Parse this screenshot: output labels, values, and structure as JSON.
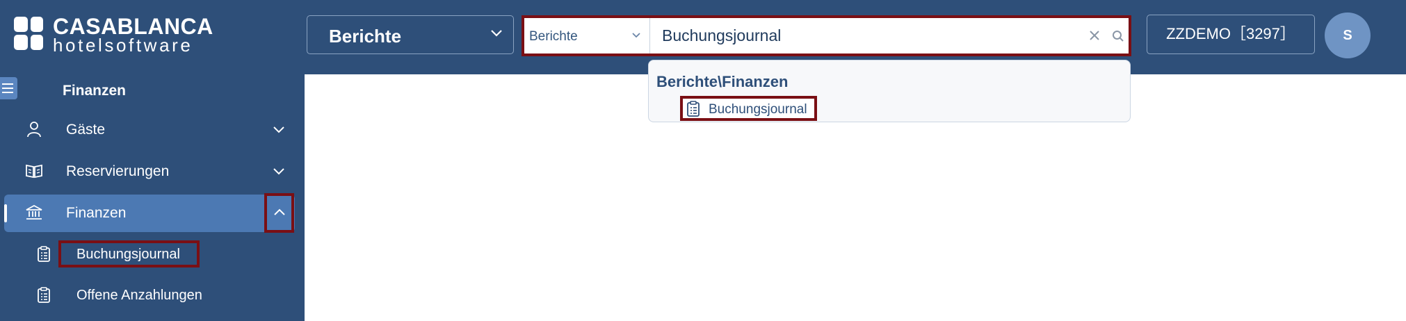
{
  "app": {
    "logo_line1": "CASABLANCA",
    "logo_line2": "hotelsoftware"
  },
  "header": {
    "module_select": {
      "selected": "Berichte"
    },
    "search": {
      "scope_selected": "Berichte",
      "value": "Buchungsjournal"
    },
    "tenant_button": "ZZDEMO［3297］",
    "avatar_initial": "S"
  },
  "dropdown": {
    "group_title": "Berichte\\Finanzen",
    "items": [
      {
        "label": "Buchungsjournal",
        "icon": "clipboard-icon"
      }
    ]
  },
  "sidebar": {
    "section_title": "Finanzen",
    "items": [
      {
        "label": "Gäste",
        "icon": "person-icon",
        "expanded": false
      },
      {
        "label": "Reservierungen",
        "icon": "book-icon",
        "expanded": false
      },
      {
        "label": "Finanzen",
        "icon": "bank-icon",
        "expanded": true,
        "active": true
      }
    ],
    "sub_items": [
      {
        "label": "Buchungsjournal",
        "icon": "clipboard-icon"
      },
      {
        "label": "Offene Anzahlungen",
        "icon": "clipboard-icon"
      }
    ]
  },
  "colors": {
    "header_bg": "#2e4f79",
    "active_item_bg": "#4c79b3",
    "highlight_border": "#7a0f14",
    "avatar_bg": "#6f94c4"
  }
}
